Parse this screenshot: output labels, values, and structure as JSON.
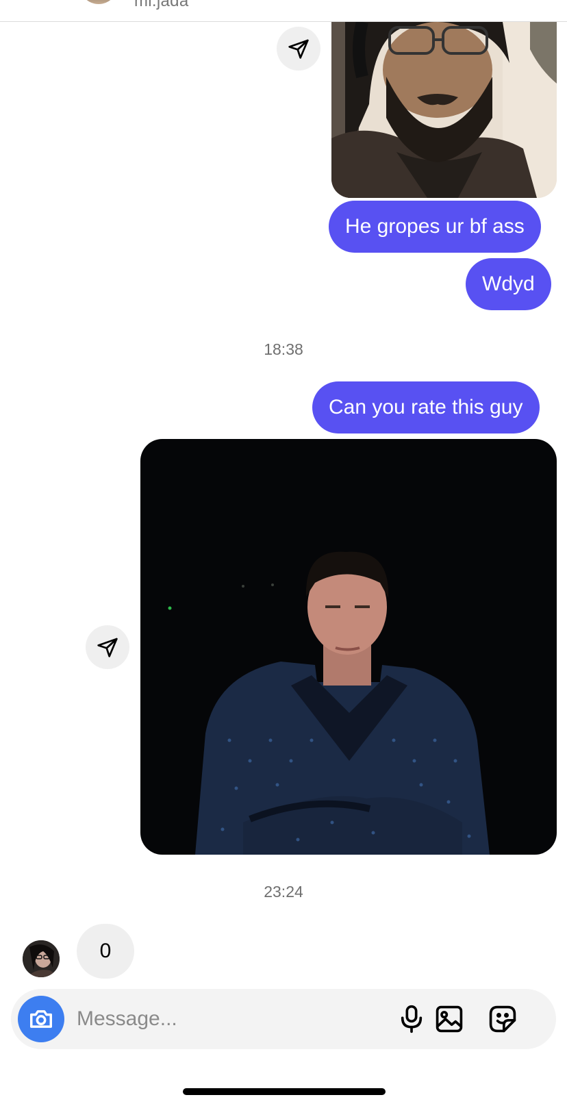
{
  "header": {
    "username": "mi.jada"
  },
  "messages": {
    "outgoing_1": "He gropes ur bf ass",
    "outgoing_2": "Wdyd",
    "timestamp_1": "18:38",
    "outgoing_3": "Can you rate this guy",
    "timestamp_2": "23:24",
    "incoming_1": "0"
  },
  "composer": {
    "placeholder": "Message..."
  },
  "icons": {
    "share": "paper-plane-icon",
    "camera": "camera-icon",
    "microphone": "microphone-icon",
    "gallery": "image-icon",
    "sticker": "sticker-icon"
  },
  "colors": {
    "outgoing_bubble": "#5851f2",
    "incoming_bubble": "#efefef",
    "camera_button": "#3d7ef0",
    "composer_background": "#f3f3f3"
  }
}
